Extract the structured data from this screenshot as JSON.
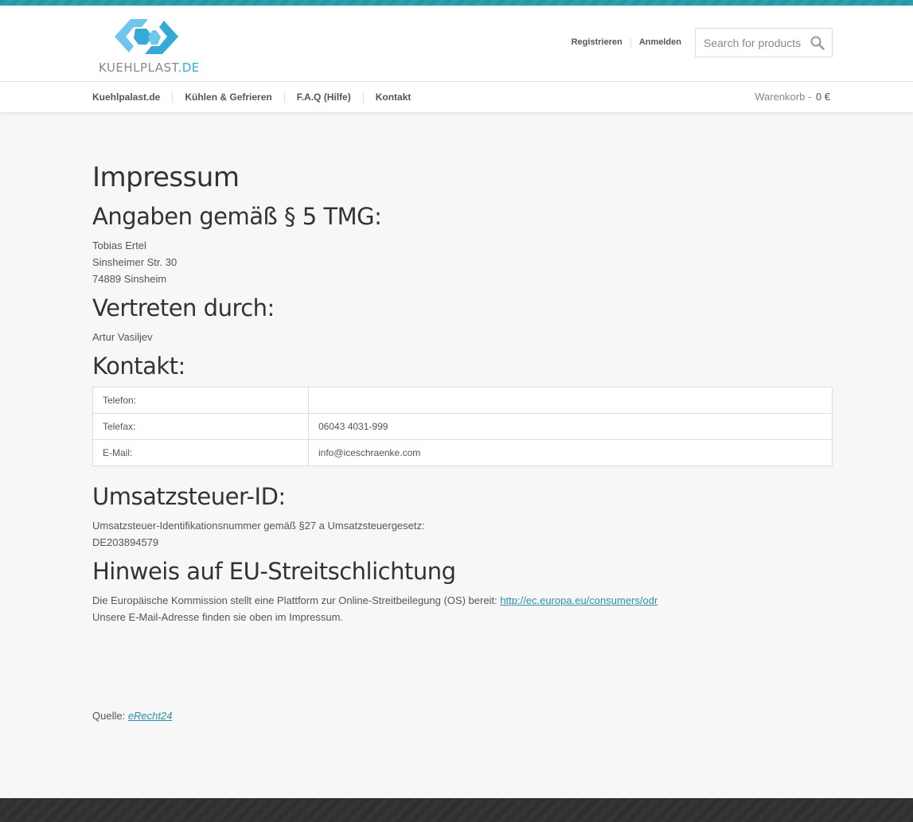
{
  "brand": {
    "logo_text": "KUEHLPLAST",
    "logo_tld": ".DE",
    "accent_color": "#2896a6",
    "logo_color": "#35aad6"
  },
  "account": {
    "register_label": "Registrieren",
    "login_label": "Anmelden"
  },
  "search": {
    "placeholder": "Search for products",
    "icon": "search-icon"
  },
  "nav": {
    "items": [
      {
        "label": "Kuehlpalast.de"
      },
      {
        "label": "Kühlen & Gefrieren"
      },
      {
        "label": "F.A.Q (Hilfe)"
      },
      {
        "label": "Kontakt"
      }
    ]
  },
  "cart": {
    "label": "Warenkorb -",
    "amount": "0 €"
  },
  "page": {
    "title": "Impressum",
    "section_tmg": {
      "heading": "Angaben gemäß § 5 TMG:",
      "lines": [
        "Tobias Ertel",
        "Sinsheimer Str. 30",
        "74889 Sinsheim"
      ]
    },
    "section_rep": {
      "heading": "Vertreten durch:",
      "name": "Artur Vasiljev"
    },
    "section_contact": {
      "heading": "Kontakt:",
      "rows": [
        {
          "label": "Telefon:",
          "value": ""
        },
        {
          "label": "Telefax:",
          "value": "06043 4031-999"
        },
        {
          "label": "E-Mail:",
          "value": "info@iceschraenke.com"
        }
      ]
    },
    "section_vat": {
      "heading": "Umsatzsteuer-ID:",
      "line1": "Umsatzsteuer-Identifikationsnummer gemäß §27 a Umsatzsteuergesetz:",
      "line2": "DE203894579"
    },
    "section_eu": {
      "heading": "Hinweis auf EU-Streitschlichtung",
      "text": "Die Europäische Kommission stellt eine Plattform zur Online-Streitbeilegung (OS) bereit: ",
      "link": "http://ec.europa.eu/consumers/odr",
      "line2": "Unsere E-Mail-Adresse finden sie oben im Impressum."
    },
    "source": {
      "label": "Quelle: ",
      "link": "eRecht24"
    }
  }
}
